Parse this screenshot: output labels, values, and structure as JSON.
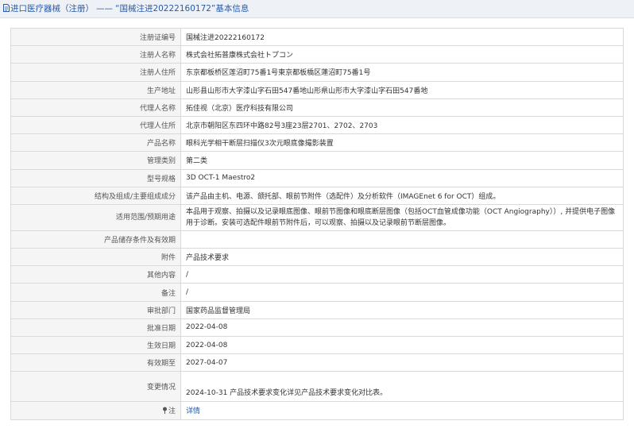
{
  "header": {
    "category_link": "进口医疗器械（注册）",
    "separator": "——",
    "title": "“国械注进20222160172”基本信息"
  },
  "rows": [
    {
      "label": "注册证编号",
      "value": "国械注进20222160172"
    },
    {
      "label": "注册人名称",
      "value": "株式会社拓普康株式会社トプコン"
    },
    {
      "label": "注册人住所",
      "value": "东京都板桥区莲沼町75番1号東京都板橋区蓮沼町75番1号"
    },
    {
      "label": "生产地址",
      "value": "山形县山形市大字漆山字石田547番地山形県山形市大字漆山字石田547番地"
    },
    {
      "label": "代理人名称",
      "value": "拓佳视（北京）医疗科技有限公司"
    },
    {
      "label": "代理人住所",
      "value": "北京市朝阳区东四环中路82号3座23层2701、2702、2703"
    },
    {
      "label": "产品名称",
      "value": "眼科光学相干断层扫描仪3次元眼底像撮影装置"
    },
    {
      "label": "管理类别",
      "value": "第二类"
    },
    {
      "label": "型号规格",
      "value": "3D OCT-1 Maestro2"
    },
    {
      "label": "结构及组成/主要组成成分",
      "value": "该产品由主机、电源、颌托部、眼前节附件（选配件）及分析软件（IMAGEnet 6 for OCT）组成。"
    },
    {
      "label": "适用范围/预期用途",
      "value": "本品用于观察、拍摄以及记录眼底图像、眼前节图像和眼底断层图像（包括OCT血管成像功能（OCT Angiography））, 并提供电子图像用于诊断。安装可选配件眼前节附件后，可以观察、拍摄以及记录眼前节断层图像。"
    },
    {
      "label": "产品储存条件及有效期",
      "value": ""
    },
    {
      "label": "附件",
      "value": "产品技术要求"
    },
    {
      "label": "其他内容",
      "value": "/"
    },
    {
      "label": "备注",
      "value": "/"
    },
    {
      "label": "审批部门",
      "value": "国家药品监督管理局"
    },
    {
      "label": "批准日期",
      "value": "2022-04-08"
    },
    {
      "label": "生效日期",
      "value": "2022-04-08"
    },
    {
      "label": "有效期至",
      "value": "2027-04-07"
    },
    {
      "label": "变更情况",
      "value": "2024-10-31 产品技术要求变化详见产品技术要求变化对比表。"
    }
  ],
  "note_row": {
    "label": "注",
    "link": "详情"
  },
  "icons": {
    "header": "document-icon",
    "note": "pin-icon"
  },
  "colors": {
    "link": "#2a5aa5",
    "label_bg": "#f5f5f5",
    "border": "#d9d9d9",
    "header_bg": "#eef1f6"
  }
}
